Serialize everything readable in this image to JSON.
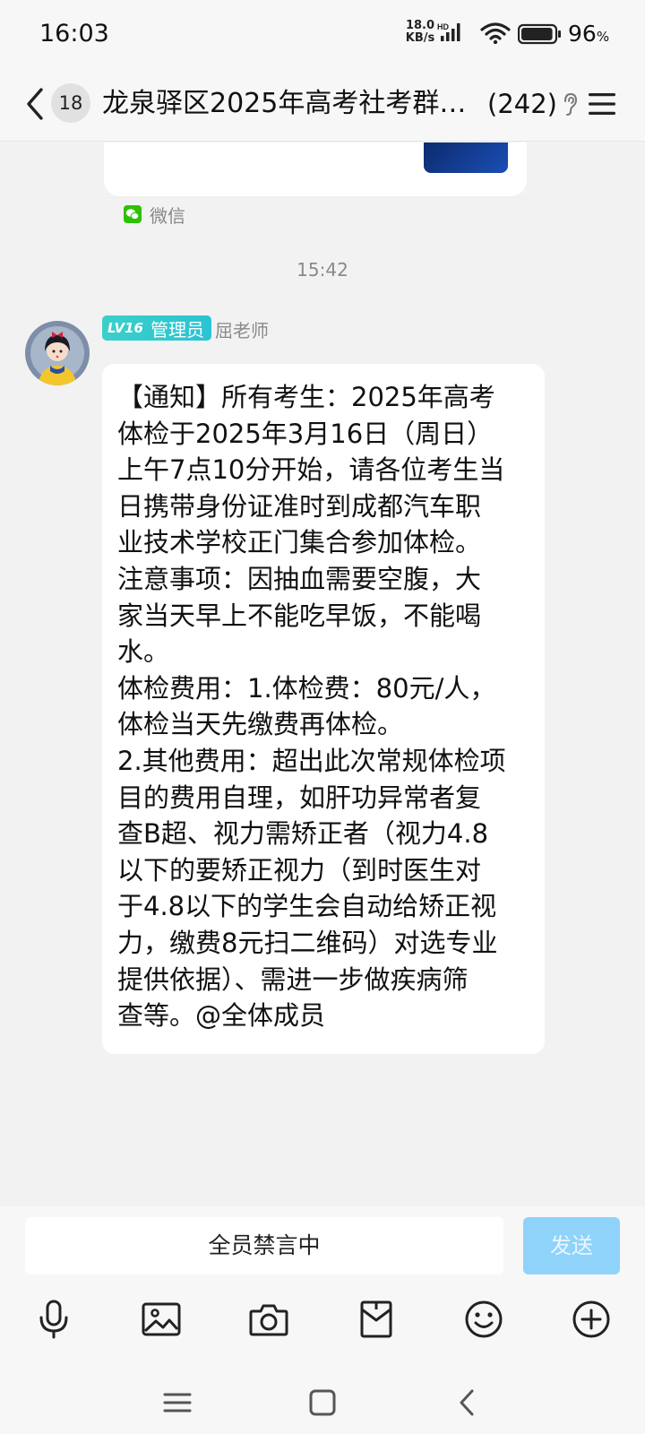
{
  "status_bar": {
    "time": "16:03",
    "net_speed_value": "18.0",
    "net_speed_unit": "KB/s",
    "hd_label": "HD",
    "battery_percent": "96",
    "battery_unit": "%",
    "battery_level": 0.96
  },
  "header": {
    "unread_count": "18",
    "title": "龙泉驿区2025年高考社考群…",
    "member_count": "(242)"
  },
  "shared_card": {
    "source_label": "微信"
  },
  "message": {
    "timestamp": "15:42",
    "level": "LV16",
    "role": "管理员",
    "sender": "屈老师",
    "lines": [
      "【通知】所有考生：2025年高考",
      "体检于2025年3月16日（周日）",
      "上午7点10分开始，请各位考生当",
      "日携带身份证准时到成都汽车职",
      "业技术学校正门集合参加体检。",
      "注意事项：因抽血需要空腹，大",
      "家当天早上不能吃早饭，不能喝",
      "水。",
      "体检费用：1.体检费：80元/人，",
      "体检当天先缴费再体检。",
      "2.其他费用：超出此次常规体检项",
      "目的费用自理，如肝功异常者复",
      "查B超、视力需矫正者（视力4.8",
      "以下的要矫正视力（到时医生对",
      "于4.8以下的学生会自动给矫正视",
      "力，缴费8元扫二维码）对选专业",
      "提供依据）、需进一步做疾病筛",
      "查等。@全体成员"
    ]
  },
  "input_bar": {
    "muted_text": "全员禁言中",
    "send_label": "发送"
  },
  "toolbar_icons": [
    "microphone-icon",
    "image-icon",
    "camera-icon",
    "red-packet-icon",
    "emoji-icon",
    "plus-icon"
  ],
  "colors": {
    "level_badge": "#3ad0c9",
    "send_button": "#8fd3fb",
    "wechat_green": "#2dc100",
    "background": "#f2f2f2"
  }
}
